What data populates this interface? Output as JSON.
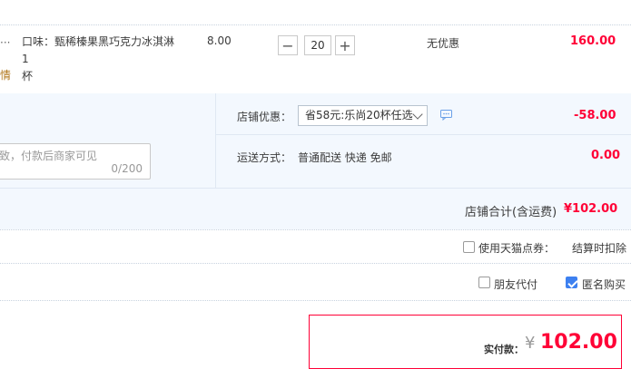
{
  "item": {
    "spec": "口味：甄稀榛果黑巧克力冰淇淋1杯",
    "spec_line1": "口味：甄稀榛果黑巧克力冰淇淋1",
    "spec_line2": "杯",
    "left_fragment": "情",
    "unit_price": "8.00",
    "quantity": "20",
    "minus": "−",
    "plus": "+",
    "discount": "无优惠",
    "subtotal": "160.00"
  },
  "shop": {
    "promo_label": "店铺优惠：",
    "promo_selected": "省58元:乐尚20杯任选",
    "promo_amount": "-58.00",
    "shipping_label": "运送方式：",
    "shipping_value": "普通配送 快递 免邮",
    "shipping_fee": "0.00",
    "message_placeholder": "致，付款后商家可见",
    "message_count": "0/200",
    "total_label": "店铺合计(含运费)",
    "total_value": "¥102.00"
  },
  "options": {
    "tmall_points_label": "使用天猫点券：",
    "tmall_points_checked": false,
    "deduct_note": "结算时扣除",
    "friend_pay_label": "朋友代付",
    "friend_pay_checked": false,
    "anonymous_label": "匿名购买",
    "anonymous_checked": true
  },
  "payment": {
    "label": "实付款：",
    "currency": "¥",
    "amount": "102.00"
  },
  "colors": {
    "accent": "#ff0036",
    "panel_bg": "#f3f8fe",
    "checkbox_on": "#3d80f0"
  }
}
